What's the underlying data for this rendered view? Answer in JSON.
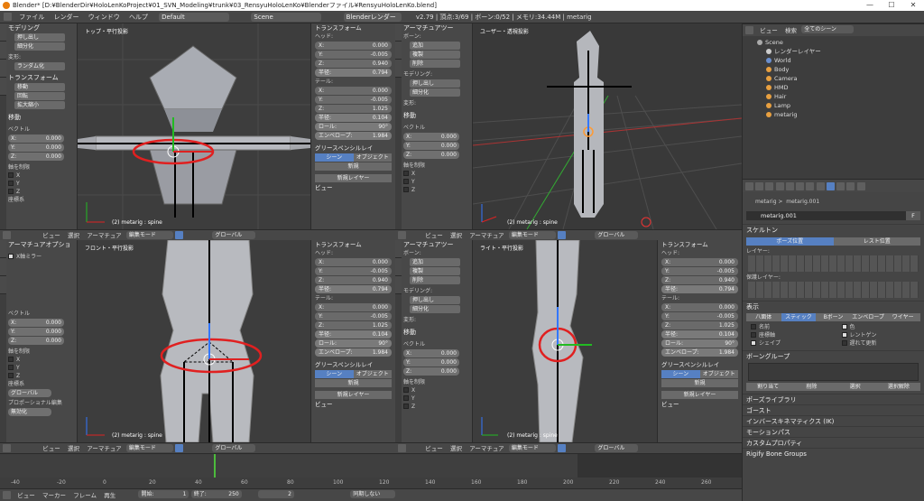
{
  "window": {
    "title": "Blender* [D:¥BlenderDir¥HoloLenKoProject¥01_SVN_Modeling¥trunk¥03_RensyuHoloLenKo¥Blenderファイル¥RensyuHoloLenKo.blend]",
    "min": "—",
    "max": "☐",
    "close": "✕"
  },
  "menu": {
    "items": [
      "ファイル",
      "レンダー",
      "ウィンドウ",
      "ヘルプ"
    ],
    "layout": "Default",
    "scene": "Scene",
    "engine": "Blenderレンダー",
    "stats": "v2.79 | 頂点:3/69 | ボーン:0/52 | メモリ:34.44M | metarig"
  },
  "toolshelf": {
    "s1": "モデリング",
    "extrude": "押し出し",
    "subdivide": "細分化",
    "deform_lbl": "変形:",
    "randomize": "ランダム化",
    "tools_hdr": "トランスフォーム",
    "move": "移動",
    "rotate": "回転",
    "scale": "拡大縮小",
    "move_hdr": "移動",
    "vector": "ベクトル",
    "x": "X:",
    "y": "Y:",
    "z": "Z:",
    "val": "0.000",
    "constraint": "軸を制限",
    "cx": "X",
    "cy": "Y",
    "cz": "Z",
    "orient": "座標系",
    "global": "グローバル",
    "arm_opts": "アーマチュアオプショ",
    "xmirror": "X軸ミラー",
    "propedit": "プロポーショナル編集",
    "disabled": "無効化"
  },
  "vp_tl": {
    "label": "トップ・平行投影",
    "footer": "(2) metarig : spine"
  },
  "vp_tr": {
    "label": "ユーザー・透視投影",
    "footer": "(2) metarig : spine"
  },
  "vp_bl": {
    "label": "フロント・平行投影",
    "footer": "(2) metarig : spine"
  },
  "vp_br": {
    "label": "ライト・平行投影",
    "footer": "(2) metarig : spine"
  },
  "npanel": {
    "transform": "トランスフォーム",
    "head": "ヘッド:",
    "tail": "テール:",
    "x": "X:",
    "y": "Y:",
    "z": "Z:",
    "hx": "0.000",
    "hy": "-0.005",
    "hz": "0.940",
    "radius": "半径:",
    "hr": "0.794",
    "tx": "0.000",
    "ty": "-0.005",
    "tz": "1.025",
    "tr": "0.104",
    "roll": "ロール:",
    "rollv": "90°",
    "envelope": "エンベロープ:",
    "envv": "1.984",
    "gpencil": "グリースペンシルレイ",
    "scene": "シーン",
    "object": "オブジェクト",
    "new": "新規",
    "newlayer": "新規レイヤー",
    "view": "ビュー"
  },
  "armshelf": {
    "title": "アーマチュアツー",
    "bones": "ボーン:",
    "add": "追加",
    "dup": "複製",
    "del": "削除",
    "modeling": "モデリング:",
    "extrude": "押し出し",
    "subdiv": "細分化",
    "deform": "変形:"
  },
  "vphdr": {
    "view": "ビュー",
    "select": "選択",
    "armature": "アーマチュア",
    "mode": "編集モード",
    "global": "グローバル"
  },
  "outliner": {
    "view": "ビュー",
    "search": "検索",
    "filter": "全てのシーン",
    "items": [
      "Scene",
      "レンダーレイヤー",
      "World",
      "Body",
      "Camera",
      "HMD",
      "Hair",
      "Lamp",
      "metarig"
    ]
  },
  "props": {
    "path1": "metarig",
    "path2": "metarig.001",
    "name": "metarig.001",
    "f": "F",
    "skeleton": "スケルトン",
    "pose": "ポーズ位置",
    "rest": "レスト位置",
    "layers": "レイヤー:",
    "protected": "保護レイヤー:",
    "display": "表示",
    "octa": "八面体",
    "stick": "スティック",
    "bbone": "Bボーン",
    "envelope": "エンベロープ",
    "wire": "ワイヤー",
    "names": "名前",
    "axes": "座標軸",
    "shape": "シェイプ",
    "colors": "色",
    "xray": "レントゲン",
    "delay": "遅れて更新",
    "bonegroup": "ボーングループ",
    "assign": "割り当て",
    "remove": "削除",
    "sel": "選択",
    "desel": "選択解除",
    "poselib": "ポーズライブラリ",
    "ghost": "ゴースト",
    "ik": "インバースキネマティクス (IK)",
    "motion": "モーションパス",
    "custom": "カスタムプロパティ",
    "rigify": "Rigify Bone Groups"
  },
  "timeline": {
    "ticks": [
      "-40",
      "-20",
      "0",
      "20",
      "40",
      "60",
      "80",
      "100",
      "120",
      "140",
      "160",
      "180",
      "200",
      "220",
      "240",
      "260"
    ],
    "view": "ビュー",
    "marker": "マーカー",
    "frame": "フレーム",
    "play": "再生",
    "start": "開始:",
    "startv": "1",
    "end": "終了:",
    "endv": "250",
    "cur": "2",
    "sync": "同期しない"
  }
}
